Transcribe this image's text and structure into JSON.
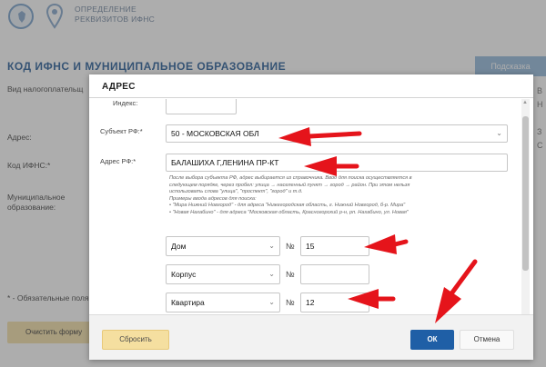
{
  "header": {
    "title_line1": "ОПРЕДЕЛЕНИЕ",
    "title_line2": "РЕКВИЗИТОВ ИФНС"
  },
  "page": {
    "section_title": "КОД ИФНС И МУНИЦИПАЛЬНОЕ ОБРАЗОВАНИЕ",
    "help_tab": "Подсказка",
    "labels": {
      "payer_type": "Вид налогоплательщ",
      "address": "Адрес:",
      "ifns_code": "Код ИФНС:*",
      "municipal_line1": "Муниципальное",
      "municipal_line2": "образование:",
      "required_note": "* - Обязательные поля"
    },
    "clear_button": "Очистить форму"
  },
  "modal": {
    "title": "АДРЕС",
    "index_label": "Индекс:",
    "index_value": "",
    "subject_label": "Субъект РФ:*",
    "subject_value": "50 - МОСКОВСКАЯ ОБЛ",
    "address_label": "Адрес РФ:*",
    "address_value": "БАЛАШИХА Г,ЛЕНИНА ПР-КТ",
    "hint": {
      "line1": "После выбора субъекта РФ, адрес выбирается из справочника. Ввод для поиска осуществляется в",
      "line2": "следующем порядке, через пробел: улица → населенный пункт → город → район. При этом нельзя",
      "line3": "использовать слова \"улица\", \"проспект\", \"город\" и т.д.",
      "line4": "Примеры ввода адресов для поиска:",
      "example1": "\"Мира Нижний Новгород\" - для адреса \"Нижегородская область, г. Нижний Новгород, б-р. Мира\"",
      "example2": "\"Новая Нахабино\" - для адреса \"Московская область, Красногорский р-н, рп. Нахабино, ул. Новая\""
    },
    "number_sign": "№",
    "house_type": "Дом",
    "house_value": "15",
    "building_type": "Корпус",
    "building_value": "",
    "flat_type": "Квартира",
    "flat_value": "12",
    "reset_button": "Сбросить",
    "ok_button": "ОК",
    "cancel_button": "Отмена"
  },
  "colors": {
    "accent": "#1f5fa6",
    "section_title": "#4f7bab",
    "reset": "#f5dfa0",
    "arrow": "#e5141b"
  },
  "icons": {
    "arrow": "red-arrow-icon",
    "chevron": "chevron-down-icon",
    "emblem": "emblem-icon",
    "pin": "map-pin-icon"
  }
}
